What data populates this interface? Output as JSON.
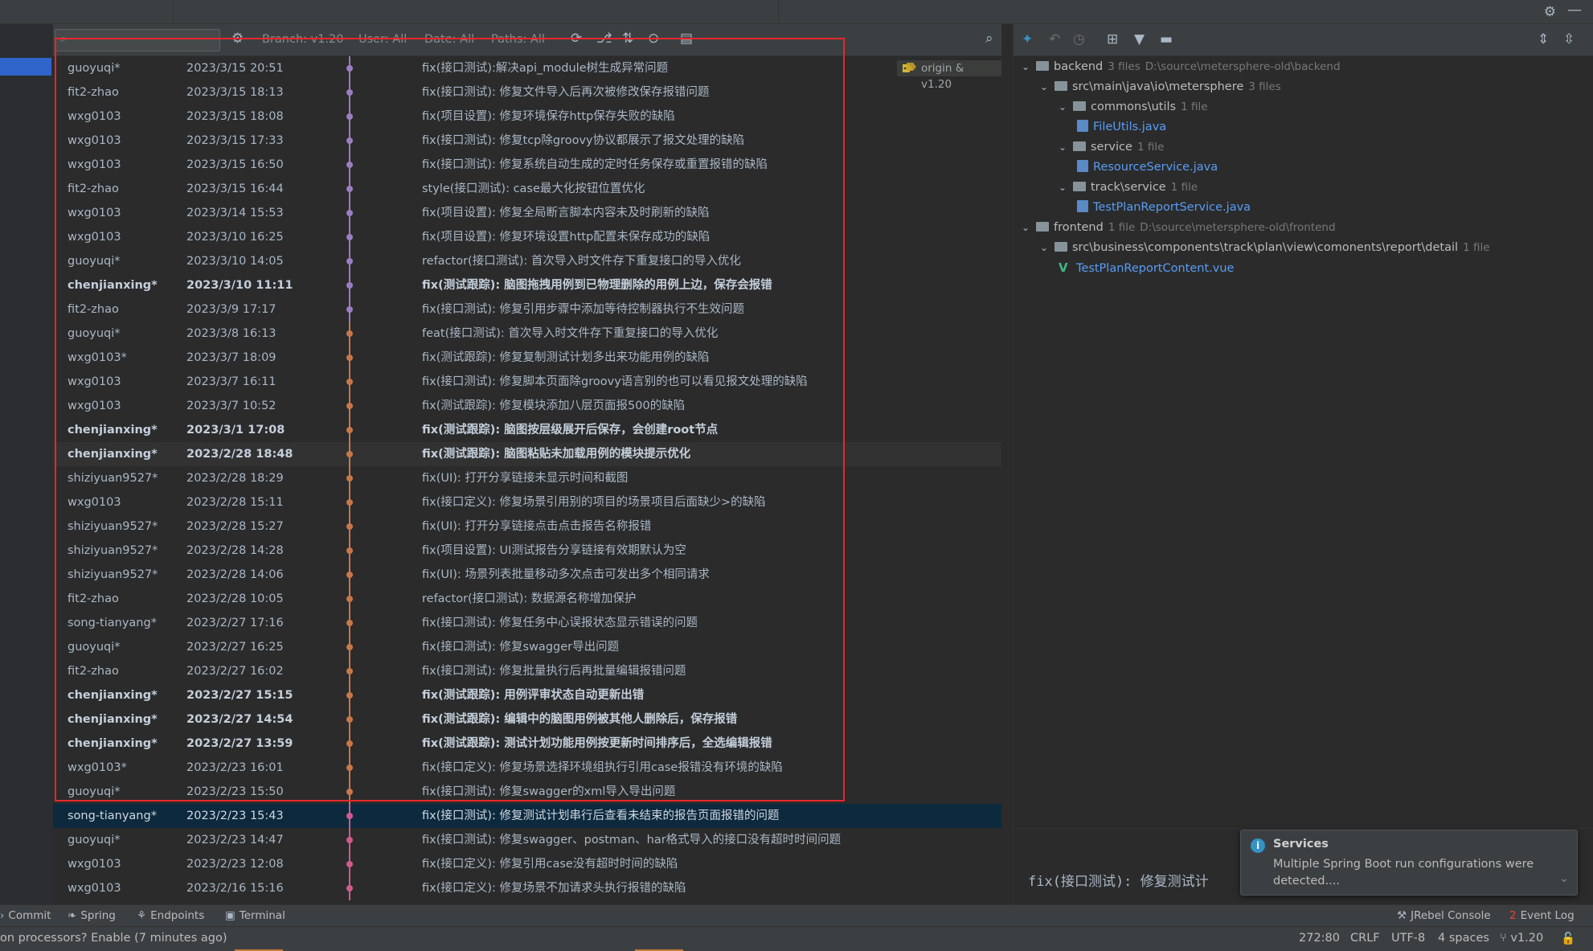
{
  "toolbar": {
    "search_placeholder": "",
    "branch_filter": "Branch: v1.20",
    "user_filter": "User: All",
    "date_filter": "Date: All",
    "paths_filter": "Paths: All"
  },
  "tag_label": "origin & v1.20",
  "commits": [
    {
      "author": "guoyuqi*",
      "date": "2023/3/15 20:51",
      "message": "fix(接口测试):解决api_module树生成异常问题",
      "bold": false
    },
    {
      "author": "fit2-zhao",
      "date": "2023/3/15 18:13",
      "message": "fix(接口测试): 修复文件导入后再次被修改保存报错问题",
      "bold": false
    },
    {
      "author": "wxg0103",
      "date": "2023/3/15 18:08",
      "message": "fix(项目设置): 修复环境保存http保存失败的缺陷",
      "bold": false
    },
    {
      "author": "wxg0103",
      "date": "2023/3/15 17:33",
      "message": "fix(接口测试): 修复tcp除groovy协议都展示了报文处理的缺陷",
      "bold": false
    },
    {
      "author": "wxg0103",
      "date": "2023/3/15 16:50",
      "message": "fix(接口测试): 修复系统自动生成的定时任务保存或重置报错的缺陷",
      "bold": false
    },
    {
      "author": "fit2-zhao",
      "date": "2023/3/15 16:44",
      "message": "style(接口测试): case最大化按钮位置优化",
      "bold": false
    },
    {
      "author": "wxg0103",
      "date": "2023/3/14 15:53",
      "message": "fix(项目设置): 修复全局断言脚本内容未及时刷新的缺陷",
      "bold": false
    },
    {
      "author": "wxg0103",
      "date": "2023/3/10 16:25",
      "message": "fix(项目设置): 修复环境设置http配置未保存成功的缺陷",
      "bold": false
    },
    {
      "author": "guoyuqi*",
      "date": "2023/3/10 14:05",
      "message": "refactor(接口测试): 首次导入时文件存下重复接口的导入优化",
      "bold": false
    },
    {
      "author": "chenjianxing*",
      "date": "2023/3/10 11:11",
      "message": "fix(测试跟踪): 脑图拖拽用例到已物理删除的用例上边，保存会报错",
      "bold": true
    },
    {
      "author": "fit2-zhao",
      "date": "2023/3/9 17:17",
      "message": "fix(接口测试): 修复引用步骤中添加等待控制器执行不生效问题",
      "bold": false
    },
    {
      "author": "guoyuqi*",
      "date": "2023/3/8 16:13",
      "message": "feat(接口测试): 首次导入时文件存下重复接口的导入优化",
      "bold": false
    },
    {
      "author": "wxg0103*",
      "date": "2023/3/7 18:09",
      "message": "fix(测试跟踪): 修复复制测试计划多出来功能用例的缺陷",
      "bold": false
    },
    {
      "author": "wxg0103",
      "date": "2023/3/7 16:11",
      "message": "fix(接口测试): 修复脚本页面除groovy语言别的也可以看见报文处理的缺陷",
      "bold": false
    },
    {
      "author": "wxg0103",
      "date": "2023/3/7 10:52",
      "message": "fix(测试跟踪): 修复模块添加八层页面报500的缺陷",
      "bold": false
    },
    {
      "author": "chenjianxing*",
      "date": "2023/3/1 17:08",
      "message": "fix(测试跟踪): 脑图按层级展开后保存，会创建root节点",
      "bold": true
    },
    {
      "author": "chenjianxing*",
      "date": "2023/2/28 18:48",
      "message": "fix(测试跟踪): 脑图粘贴未加载用例的模块提示优化",
      "bold": true
    },
    {
      "author": "shiziyuan9527*",
      "date": "2023/2/28 18:29",
      "message": "fix(UI): 打开分享链接未显示时间和截图",
      "bold": false
    },
    {
      "author": "wxg0103",
      "date": "2023/2/28 15:11",
      "message": "fix(接口定义): 修复场景引用别的项目的场景项目后面缺少>的缺陷",
      "bold": false
    },
    {
      "author": "shiziyuan9527*",
      "date": "2023/2/28 15:27",
      "message": "fix(UI): 打开分享链接点击点击报告名称报错",
      "bold": false
    },
    {
      "author": "shiziyuan9527*",
      "date": "2023/2/28 14:28",
      "message": "fix(项目设置): UI测试报告分享链接有效期默认为空",
      "bold": false
    },
    {
      "author": "shiziyuan9527*",
      "date": "2023/2/28 14:06",
      "message": "fix(UI): 场景列表批量移动多次点击可发出多个相同请求",
      "bold": false
    },
    {
      "author": "fit2-zhao",
      "date": "2023/2/28 10:05",
      "message": "refactor(接口测试): 数据源名称增加保护",
      "bold": false
    },
    {
      "author": "song-tianyang*",
      "date": "2023/2/27 17:16",
      "message": "fix(接口测试): 修复任务中心误报状态显示错误的问题",
      "bold": false
    },
    {
      "author": "guoyuqi*",
      "date": "2023/2/27 16:25",
      "message": "fix(接口测试): 修复swagger导出问题",
      "bold": false
    },
    {
      "author": "fit2-zhao",
      "date": "2023/2/27 16:02",
      "message": "fix(接口测试): 修复批量执行后再批量编辑报错问题",
      "bold": false
    },
    {
      "author": "chenjianxing*",
      "date": "2023/2/27 15:15",
      "message": "fix(测试跟踪): 用例评审状态自动更新出错",
      "bold": true
    },
    {
      "author": "chenjianxing*",
      "date": "2023/2/27 14:54",
      "message": "fix(测试跟踪): 编辑中的脑图用例被其他人删除后，保存报错",
      "bold": true
    },
    {
      "author": "chenjianxing*",
      "date": "2023/2/27 13:59",
      "message": "fix(测试跟踪): 测试计划功能用例按更新时间排序后，全选编辑报错",
      "bold": true
    },
    {
      "author": "wxg0103*",
      "date": "2023/2/23 16:01",
      "message": "fix(接口定义): 修复场景选择环境组执行引用case报错没有环境的缺陷",
      "bold": false
    },
    {
      "author": "guoyuqi*",
      "date": "2023/2/23 15:50",
      "message": "fix(接口测试): 修复swagger的xml导入导出问题",
      "bold": false
    },
    {
      "author": "song-tianyang*",
      "date": "2023/2/23 15:43",
      "message": "fix(接口测试): 修复测试计划串行后查看未结束的报告页面报错的问题",
      "bold": false
    },
    {
      "author": "guoyuqi*",
      "date": "2023/2/23 14:47",
      "message": "fix(接口测试): 修复swagger、postman、har格式导入的接口没有超时时间问题",
      "bold": false
    },
    {
      "author": "wxg0103",
      "date": "2023/2/23 12:08",
      "message": "fix(接口定义): 修复引用case没有超时时间的缺陷",
      "bold": false
    },
    {
      "author": "wxg0103",
      "date": "2023/2/16 15:16",
      "message": "fix(接口定义): 修复场景不加请求头执行报错的缺陷",
      "bold": false
    }
  ],
  "tree": [
    {
      "level": 0,
      "kind": "folder",
      "name": "backend",
      "count": "3 files",
      "path": "D:\\source\\metersphere-old\\backend"
    },
    {
      "level": 1,
      "kind": "folder",
      "name": "src\\main\\java\\io\\metersphere",
      "count": "3 files",
      "path": ""
    },
    {
      "level": 2,
      "kind": "folder",
      "name": "commons\\utils",
      "count": "1 file",
      "path": ""
    },
    {
      "level": 3,
      "kind": "java",
      "name": "FileUtils.java",
      "count": "",
      "path": ""
    },
    {
      "level": 2,
      "kind": "folder",
      "name": "service",
      "count": "1 file",
      "path": ""
    },
    {
      "level": 3,
      "kind": "java",
      "name": "ResourceService.java",
      "count": "",
      "path": ""
    },
    {
      "level": 2,
      "kind": "folder",
      "name": "track\\service",
      "count": "1 file",
      "path": ""
    },
    {
      "level": 3,
      "kind": "java",
      "name": "TestPlanReportService.java",
      "count": "",
      "path": ""
    },
    {
      "level": 0,
      "kind": "folder",
      "name": "frontend",
      "count": "1 file",
      "path": "D:\\source\\metersphere-old\\frontend"
    },
    {
      "level": 1,
      "kind": "folder",
      "name": "src\\business\\components\\track\\plan\\view\\comonents\\report\\detail",
      "count": "1 file",
      "path": ""
    },
    {
      "level": 2,
      "kind": "vue",
      "name": "TestPlanReportContent.vue",
      "count": "",
      "path": ""
    }
  ],
  "commit_preview": "fix(接口测试): 修复测试计",
  "notification": {
    "title": "Services",
    "body": "Multiple Spring Boot run configurations were detected...."
  },
  "toolwindows": {
    "commit": "Commit",
    "spring": "Spring",
    "endpoints": "Endpoints",
    "terminal": "Terminal",
    "jrebel": "JRebel Console",
    "eventlog": "Event Log",
    "eventlog_badge": "2"
  },
  "status": {
    "left": "on processors? Enable (7 minutes ago)",
    "position": "272:80",
    "line_sep": "CRLF",
    "encoding": "UTF-8",
    "indent": "4 spaces",
    "branch": "v1.20"
  },
  "colors": {
    "graph_purple": "#9b7dc4",
    "graph_orange": "#c8774a",
    "graph_pink": "#d05a8f",
    "highlight_red": "#e5282c",
    "selection": "#0d293e"
  }
}
